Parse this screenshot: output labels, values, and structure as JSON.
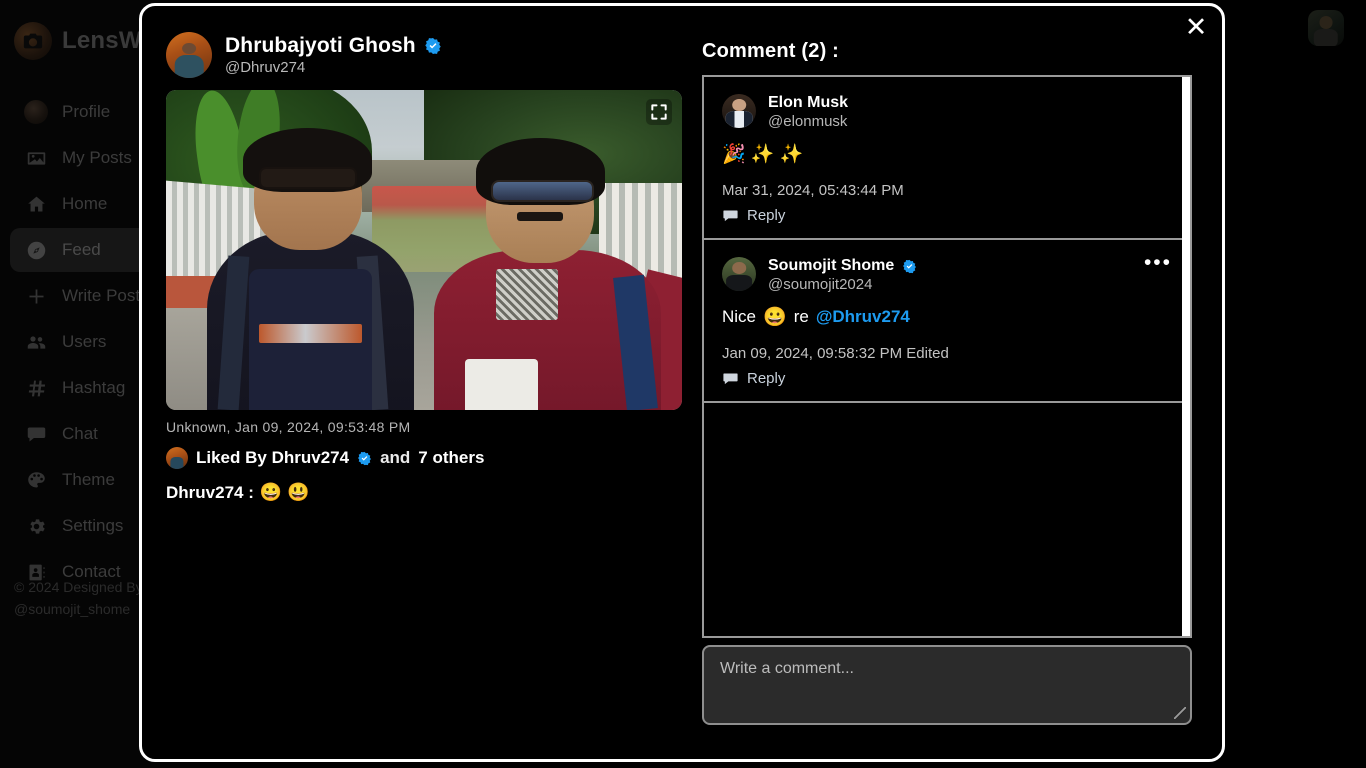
{
  "app": {
    "brand_name": "LensW",
    "logo_icon": "camera-icon",
    "copyright": "© 2024 Designed By @soumojit_shome"
  },
  "sidebar": {
    "items": [
      {
        "label": "Profile",
        "icon": "avatar-icon",
        "active": false
      },
      {
        "label": "My Posts",
        "icon": "image-icon",
        "active": false
      },
      {
        "label": "Home",
        "icon": "home-icon",
        "active": false
      },
      {
        "label": "Feed",
        "icon": "compass-icon",
        "active": true
      },
      {
        "label": "Write Post",
        "icon": "plus-icon",
        "active": false
      },
      {
        "label": "Users",
        "icon": "users-icon",
        "active": false
      },
      {
        "label": "Hashtag",
        "icon": "hashtag-icon",
        "active": false
      },
      {
        "label": "Chat",
        "icon": "chat-icon",
        "active": false
      },
      {
        "label": "Theme",
        "icon": "palette-icon",
        "active": false
      },
      {
        "label": "Settings",
        "icon": "gear-icon",
        "active": false
      },
      {
        "label": "Contact",
        "icon": "contact-card-icon",
        "active": false
      }
    ]
  },
  "topbar": {
    "avatar_name": "user-avatar"
  },
  "modal": {
    "close_label": "✕",
    "post": {
      "author_name": "Dhrubajyoti Ghosh",
      "author_handle": "@Dhruv274",
      "verified": true,
      "expand_icon": "expand-icon",
      "meta": "Unknown, Jan 09, 2024, 09:53:48 PM",
      "liked_prefix": "Liked By Dhruv274",
      "liked_mid": "and",
      "liked_others": "7 others",
      "caption_author": "Dhruv274 :",
      "caption_emojis": "😀 😃"
    },
    "comments": {
      "title": "Comment (2) :",
      "items": [
        {
          "name": "Elon Musk",
          "handle": "@elonmusk",
          "verified": false,
          "text": "🎉 ✨ ✨",
          "date": "Mar 31, 2024, 05:43:44 PM",
          "reply_label": "Reply",
          "has_more_menu": false
        },
        {
          "name": "Soumojit Shome",
          "handle": "@soumojit2024",
          "verified": true,
          "text_before": "Nice",
          "text_emoji": "😀",
          "text_middle": "re",
          "text_mention": "@Dhruv274",
          "date": "Jan 09, 2024, 09:58:32 PM Edited",
          "reply_label": "Reply",
          "has_more_menu": true,
          "more_label": "•••"
        }
      ]
    },
    "comment_input": {
      "placeholder": "Write a comment...",
      "value": ""
    }
  },
  "colors": {
    "accent_blue": "#1d9bf0",
    "verified_blue": "#1d9bf0",
    "background": "#000000",
    "border": "#ffffff",
    "list_border": "#9a9a9a",
    "input_bg": "#2b2b2b"
  }
}
